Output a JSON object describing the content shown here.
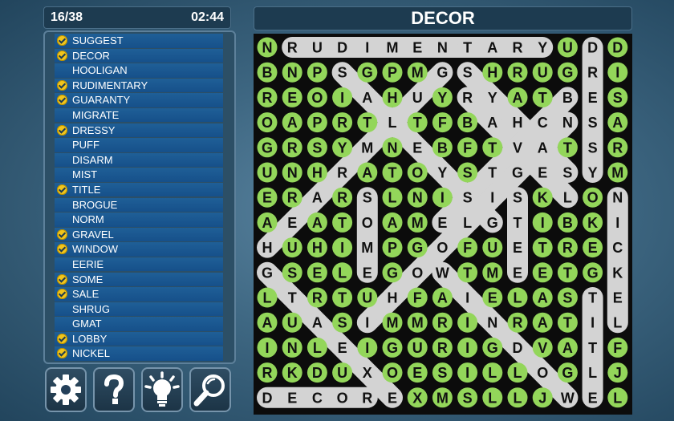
{
  "status": {
    "progress": "16/38",
    "timer": "02:44"
  },
  "puzzle_title": "DECOR",
  "word_list": [
    {
      "word": "SUGGEST",
      "found": true
    },
    {
      "word": "DECOR",
      "found": true
    },
    {
      "word": "HOOLIGAN",
      "found": false
    },
    {
      "word": "RUDIMENTARY",
      "found": true
    },
    {
      "word": "GUARANTY",
      "found": true
    },
    {
      "word": "MIGRATE",
      "found": false
    },
    {
      "word": "DRESSY",
      "found": true
    },
    {
      "word": "PUFF",
      "found": false
    },
    {
      "word": "DISARM",
      "found": false
    },
    {
      "word": "MIST",
      "found": false
    },
    {
      "word": "TITLE",
      "found": true
    },
    {
      "word": "BROGUE",
      "found": false
    },
    {
      "word": "NORM",
      "found": false
    },
    {
      "word": "GRAVEL",
      "found": true
    },
    {
      "word": "WINDOW",
      "found": true
    },
    {
      "word": "EERIE",
      "found": false
    },
    {
      "word": "SOME",
      "found": true
    },
    {
      "word": "SALE",
      "found": true
    },
    {
      "word": "SHRUG",
      "found": false
    },
    {
      "word": "GMAT",
      "found": false
    },
    {
      "word": "LOBBY",
      "found": true
    },
    {
      "word": "NICKEL",
      "found": true
    }
  ],
  "toolbar": {
    "settings_icon": "gear-icon",
    "help_icon": "question-icon",
    "hint_icon": "lightbulb-icon",
    "search_icon": "magnifier-icon"
  },
  "colors": {
    "tile_green": "#93d65a",
    "selection_gray": "#d3d3d3",
    "list_item_blue": "#1f5f97",
    "check_yellow": "#f2c51b"
  },
  "grid": {
    "rows": [
      "NRUDIMENTARYUDD",
      "BNPSGPMGSHRUGRI",
      "REOIAHUYRYATBES",
      "OAPRTLTFBAHCNSA",
      "GRSYMNEBFTVATSR",
      "UNHRATOYSTGESYM",
      "ERARSLNISISKLON",
      "AEATOAMELGTIBKI",
      "HUHIMPGOFUETREC",
      "GSELEGOWTMEETGK",
      "LTRTUHFAIELASTE",
      "AUASIMMRINRATIL",
      "INLEIGURIGDVATF",
      "RKDUXOESILLOGLJ",
      "DECOREXMSLLJWEL"
    ],
    "found_paths": [
      {
        "word": "RUDIMENTARY",
        "from": [
          0,
          1
        ],
        "to": [
          0,
          11
        ]
      },
      {
        "word": "DECOR",
        "from": [
          14,
          0
        ],
        "to": [
          14,
          4
        ]
      },
      {
        "word": "DRESSY",
        "from": [
          0,
          13
        ],
        "to": [
          5,
          13
        ]
      },
      {
        "word": "NICKEL",
        "from": [
          6,
          14
        ],
        "to": [
          11,
          14
        ]
      },
      {
        "word": "TITLE",
        "from": [
          10,
          13
        ],
        "to": [
          14,
          13
        ]
      },
      {
        "word": "SOME",
        "from": [
          6,
          4
        ],
        "to": [
          9,
          4
        ]
      },
      {
        "word": "SALE",
        "from": [
          6,
          10
        ],
        "to": [
          9,
          10
        ]
      },
      {
        "word": "LOBBY",
        "from": [
          6,
          12
        ],
        "to": [
          2,
          8
        ]
      },
      {
        "word": "GRAVEL",
        "from": [
          9,
          0
        ],
        "to": [
          14,
          5
        ]
      },
      {
        "word": "GUARANTY",
        "from": [
          1,
          7
        ],
        "to": [
          8,
          0
        ]
      },
      {
        "word": "WINDOW",
        "from": [
          9,
          7
        ],
        "to": [
          14,
          12
        ]
      },
      {
        "word": "SUGGEST",
        "from": [
          1,
          3
        ],
        "to": [
          7,
          9
        ]
      },
      {
        "word": "SHRUG",
        "from": [
          1,
          8
        ],
        "to": [
          5,
          12
        ]
      },
      {
        "word": "MIGRATE",
        "from": [
          11,
          4
        ],
        "to": [
          5,
          10
        ]
      },
      {
        "word": "BROGUE",
        "from": [
          2,
          12
        ],
        "to": [
          7,
          7
        ]
      },
      {
        "word": "HOOLIGAN",
        "from": [
          10,
          5
        ],
        "to": [
          3,
          12
        ]
      }
    ]
  }
}
